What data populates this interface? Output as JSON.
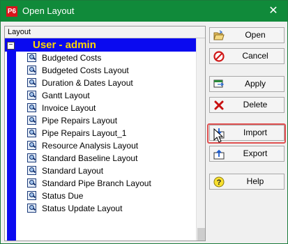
{
  "window": {
    "app_icon_text": "P6",
    "title": "Open Layout",
    "close_glyph": "✕",
    "colors": {
      "titlebar": "#108a3a",
      "group_band": "#0a0af0",
      "group_text": "#ffd700",
      "highlight": "#e05050"
    }
  },
  "list": {
    "header": "Layout",
    "group": {
      "collapse_glyph": "−",
      "label": "User - admin"
    },
    "items": [
      "Budgeted Costs",
      "Budgeted Costs Layout",
      "Duration & Dates Layout",
      "Gantt Layout",
      "Invoice Layout",
      "Pipe Repairs Layout",
      "Pipe Repairs Layout_1",
      "Resource Analysis Layout",
      "Standard Baseline Layout",
      "Standard Layout",
      "Standard Pipe Branch Layout",
      "Status Due",
      "Status Update Layout"
    ]
  },
  "buttons": {
    "open": "Open",
    "cancel": "Cancel",
    "apply": "Apply",
    "delete": "Delete",
    "import": "Import",
    "export": "Export",
    "help": "Help"
  },
  "icons": {
    "open": "folder-open-icon",
    "cancel": "no-entry-icon",
    "apply": "apply-layout-icon",
    "delete": "red-x-icon",
    "import": "import-arrow-icon",
    "export": "export-arrow-icon",
    "help": "question-mark-icon"
  }
}
